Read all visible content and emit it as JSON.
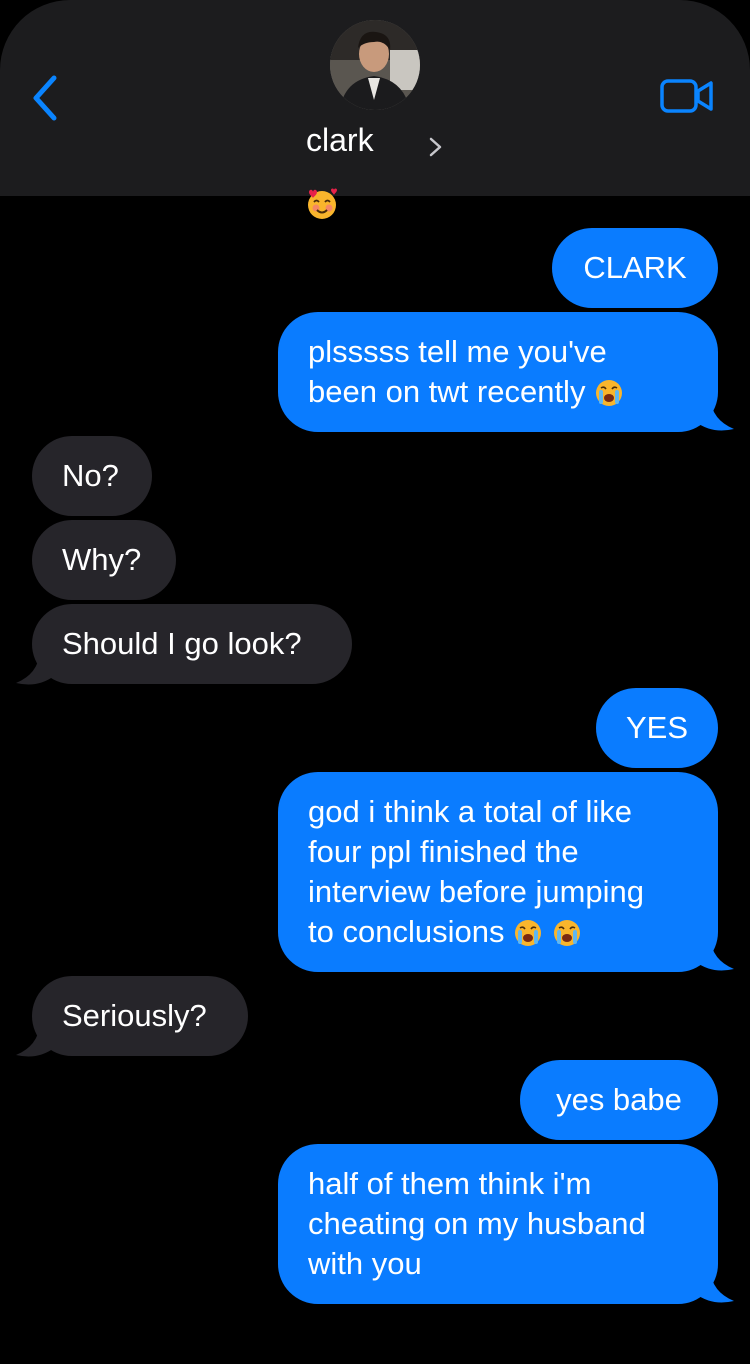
{
  "header": {
    "contact_name": "clark",
    "back_icon": "chevron-left-icon",
    "video_icon": "video-camera-icon",
    "reaction_emoji": "smiling-face-with-hearts"
  },
  "colors": {
    "sent_bubble": "#0a7cff",
    "received_bubble": "#26252a",
    "header_bg": "#1c1c1e",
    "accent": "#0a84ff"
  },
  "messages": [
    {
      "side": "sent",
      "text": "CLARK"
    },
    {
      "side": "sent",
      "lines": [
        "plsssss tell me you've",
        "been on twt recently"
      ],
      "emoji": [
        "loudly-crying-face"
      ]
    },
    {
      "side": "received",
      "text": "No?"
    },
    {
      "side": "received",
      "text": "Why?"
    },
    {
      "side": "received",
      "text": "Should I go look?"
    },
    {
      "side": "sent",
      "text": "YES"
    },
    {
      "side": "sent",
      "lines": [
        "god i think a total of like",
        "four ppl finished the",
        "interview before jumping",
        "to conclusions"
      ],
      "emoji": [
        "loudly-crying-face",
        "loudly-crying-face"
      ]
    },
    {
      "side": "received",
      "text": "Seriously?"
    },
    {
      "side": "sent",
      "text": "yes babe"
    },
    {
      "side": "sent",
      "lines": [
        "half of them think i'm",
        "cheating on my husband",
        "with you"
      ]
    }
  ]
}
